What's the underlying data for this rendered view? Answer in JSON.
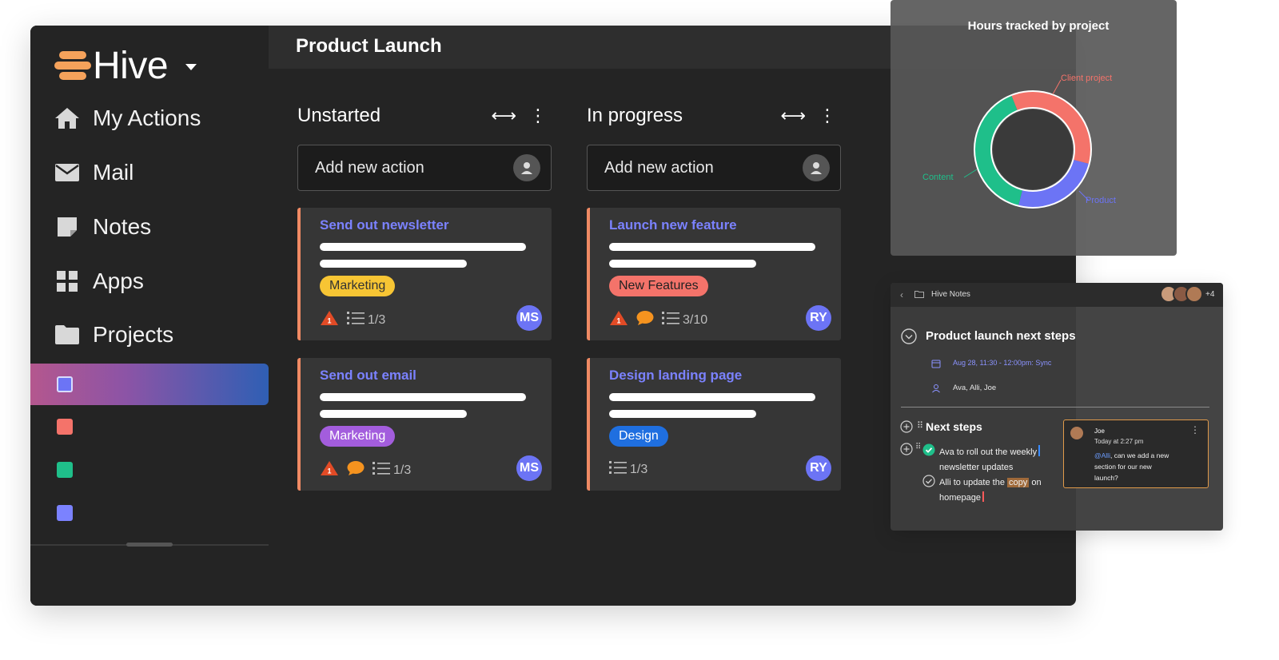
{
  "app": {
    "brand": "Hive",
    "page_title": "Product Launch"
  },
  "sidebar": {
    "items": [
      {
        "label": "My Actions",
        "icon": "home-icon"
      },
      {
        "label": "Mail",
        "icon": "mail-icon"
      },
      {
        "label": "Notes",
        "icon": "note-icon"
      },
      {
        "label": "Apps",
        "icon": "apps-grid-icon"
      },
      {
        "label": "Projects",
        "icon": "folder-icon"
      }
    ],
    "project_colors": [
      "#7b82ff",
      "#f4736a",
      "#1fbf8a",
      "#7b82ff"
    ]
  },
  "board": {
    "add_label": "Add new action",
    "columns": [
      {
        "title": "Unstarted",
        "cards": [
          {
            "title": "Send out newsletter",
            "tag": "Marketing",
            "tag_bg": "#f7c534",
            "tag_fg": "#333333",
            "alert_count": "1",
            "has_comment": false,
            "checklist": "1/3",
            "assignee": "MS"
          },
          {
            "title": "Send out email",
            "tag": "Marketing",
            "tag_bg": "#a35ddd",
            "tag_fg": "#ffffff",
            "alert_count": "1",
            "has_comment": true,
            "checklist": "1/3",
            "assignee": "MS"
          }
        ]
      },
      {
        "title": "In progress",
        "cards": [
          {
            "title": "Launch new feature",
            "tag": "New Features",
            "tag_bg": "#f4736a",
            "tag_fg": "#222222",
            "alert_count": "1",
            "has_comment": true,
            "checklist": "3/10",
            "assignee": "RY"
          },
          {
            "title": "Design landing page",
            "tag": "Design",
            "tag_bg": "#1f6fe0",
            "tag_fg": "#ffffff",
            "alert_count": "",
            "has_comment": false,
            "checklist": "1/3",
            "assignee": "RY"
          }
        ]
      }
    ]
  },
  "hours_chart": {
    "title": "Hours tracked by project",
    "slices": [
      {
        "name": "Client project",
        "value": 35,
        "color": "#f4736a"
      },
      {
        "name": "Product",
        "value": 25,
        "color": "#6c74f5"
      },
      {
        "name": "Content",
        "value": 40,
        "color": "#1fbf8a"
      }
    ]
  },
  "notes": {
    "header_title": "Hive Notes",
    "extra_people": "+4",
    "doc_title": "Product launch next steps",
    "meeting": "Aug 28, 11:30 - 12:00pm: Sync",
    "attendees": "Ava, Alli, Joe",
    "section": "Next steps",
    "tasks": [
      {
        "line1": "Ava to roll out the weekly",
        "line2": "newsletter updates",
        "done": true
      },
      {
        "line1_before": "Alli to update the ",
        "highlight": "copy",
        "line1_after": " on",
        "line2": "homepage",
        "done": false
      }
    ],
    "comment": {
      "author": "Joe",
      "time": "Today at 2:27 pm",
      "mention": "@Alli",
      "text_rest": ", can we add a new",
      "line2": "section for our new",
      "line3": "launch?"
    }
  }
}
